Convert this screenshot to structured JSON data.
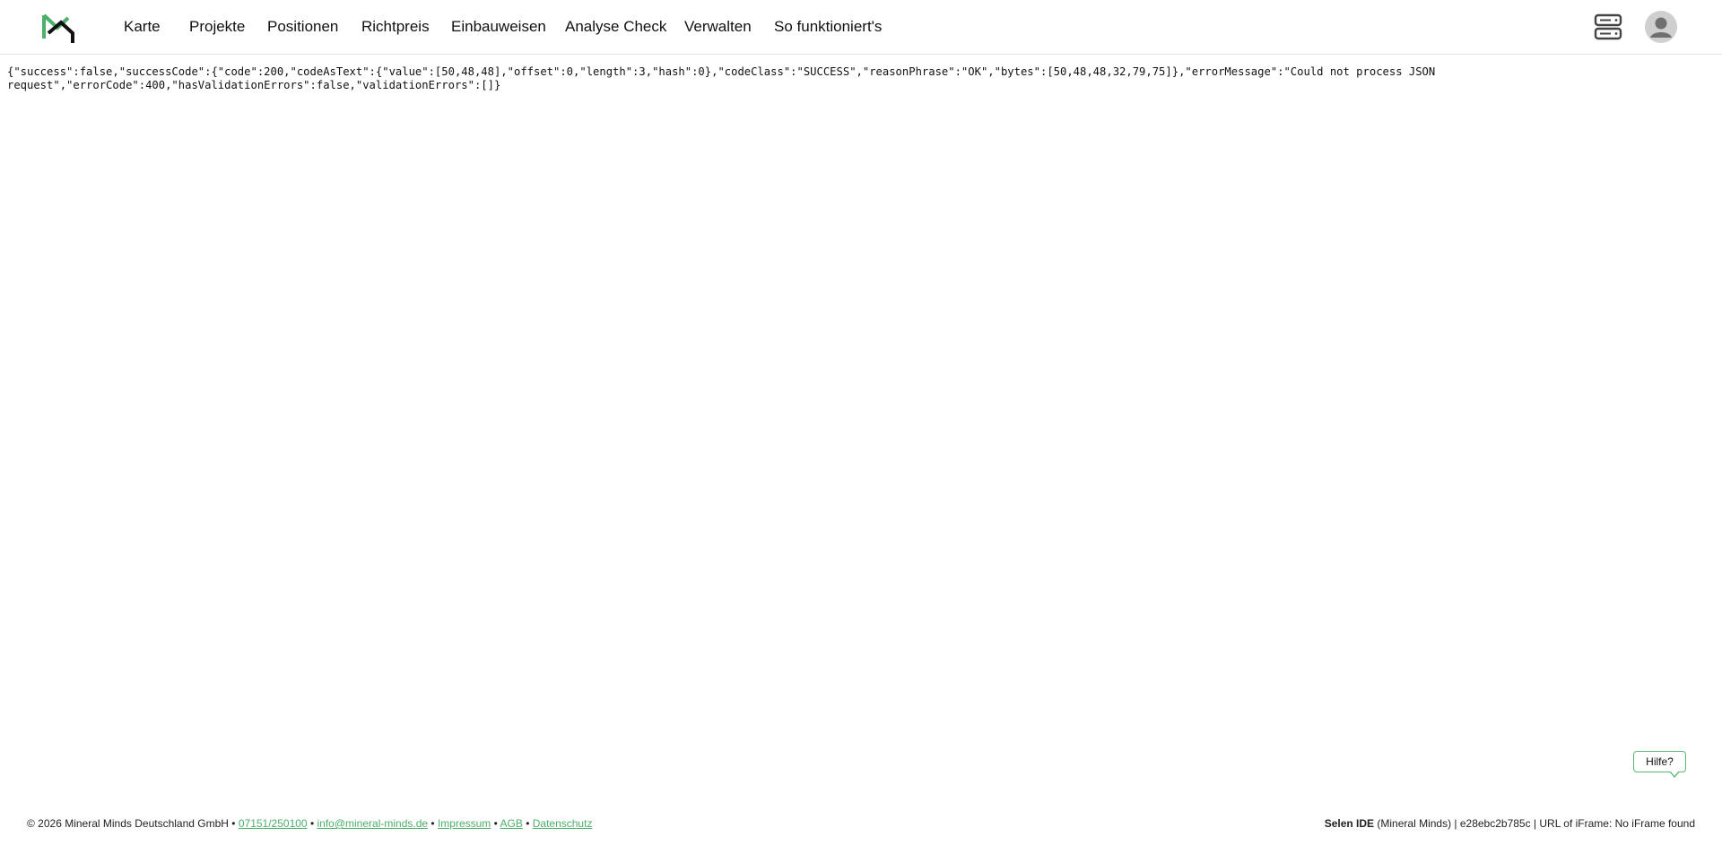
{
  "header": {
    "brand_color": "#4caf6a",
    "nav_items": [
      {
        "label": "Karte"
      },
      {
        "label": "Projekte"
      },
      {
        "label": "Positionen"
      },
      {
        "label": "Richtpreis"
      },
      {
        "label": "Einbauweisen"
      },
      {
        "label": "Analyse Check"
      },
      {
        "label": "Verwalten"
      },
      {
        "label": "So funktioniert's"
      }
    ],
    "right_icons": [
      "server-icon",
      "avatar-icon"
    ]
  },
  "main": {
    "json_lines": [
      "{\"success\":false,\"successCode\":{\"code\":200,\"codeAsText\":{\"value\":[50,48,48],\"offset\":0,\"length\":3,\"hash\":0},\"codeClass\":\"SUCCESS\",\"reasonPhrase\":\"OK\",\"bytes\":[50,48,48,32,79,75]},\"errorMessage\":\"Could not process JSON",
      "request\",\"errorCode\":400,\"hasValidationErrors\":false,\"validationErrors\":[]}"
    ]
  },
  "help": {
    "label": "Hilfe?"
  },
  "footer": {
    "copyright": "© 2026 Mineral Minds Deutschland GmbH",
    "separator": "•",
    "phone": "07151/250100",
    "email": "info@mineral-minds.de",
    "impressum": "Impressum",
    "agb": "AGB",
    "datenschutz": "Datenschutz",
    "right_bold": "Selen IDE",
    "right_text": "(Mineral Minds) | e28ebc2b785c | URL of iFrame: No iFrame found"
  }
}
